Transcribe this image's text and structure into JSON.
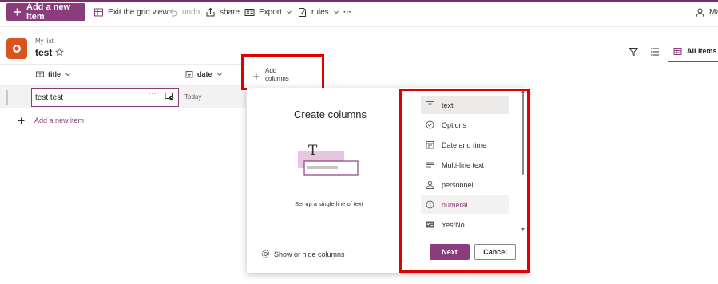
{
  "colors": {
    "accent": "#8a3d7c",
    "highlight": "#e00000",
    "list_icon": "#d9531e"
  },
  "command_bar": {
    "add_new_item": "Add a new item",
    "exit_grid_view": "Exit the grid view",
    "undo": "undo",
    "share": "share",
    "export": "Export",
    "rules": "rules",
    "more": "···",
    "user_fragment": "Mar"
  },
  "list": {
    "parent": "My list",
    "title": "test"
  },
  "views": {
    "current": "All items"
  },
  "grid": {
    "columns": [
      {
        "label": "title",
        "icon": "text-icon"
      },
      {
        "label": "date",
        "icon": "calendar-icon"
      }
    ],
    "rows": [
      {
        "title": "test test",
        "date": "Today"
      }
    ],
    "add_item": "Add a new item",
    "add_columns_line1": "Add",
    "add_columns_line2": "columns"
  },
  "create_panel": {
    "title": "Create columns",
    "description": "Set up a single line of text",
    "show_hide": "Show or hide columns",
    "options": [
      {
        "label": "text",
        "icon": "text-box-icon"
      },
      {
        "label": "Options",
        "icon": "check-circle-icon"
      },
      {
        "label": "Date and time",
        "icon": "calendar-icon"
      },
      {
        "label": "Multi-line text",
        "icon": "multiline-text-icon"
      },
      {
        "label": "personnel",
        "icon": "person-icon"
      },
      {
        "label": "numeral",
        "icon": "number-icon"
      },
      {
        "label": "Yes/No",
        "icon": "toggle-icon"
      }
    ],
    "next": "Next",
    "cancel": "Cancel",
    "preview_letter": "T"
  }
}
